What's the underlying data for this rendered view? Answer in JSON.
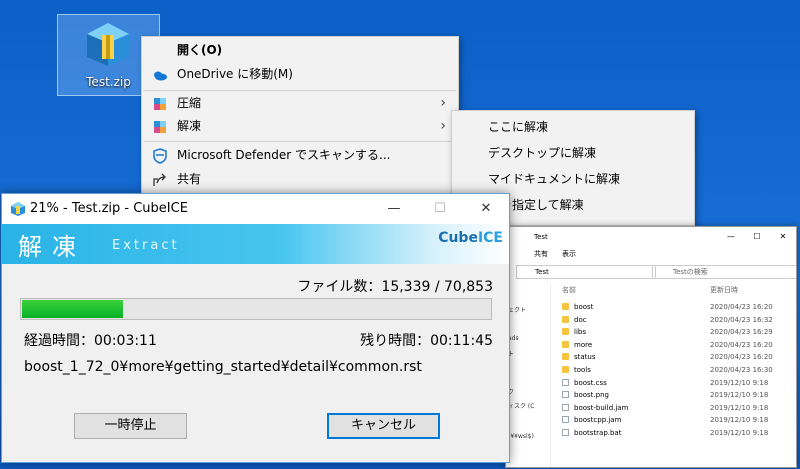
{
  "desktop": {
    "icon_label": "Test.zip"
  },
  "context_menu": {
    "items": [
      {
        "label": "開く(O)",
        "bold": true
      },
      {
        "label": "OneDrive に移動(M)"
      },
      {
        "label": "圧縮",
        "submenu": true
      },
      {
        "label": "解凍",
        "submenu": true
      },
      {
        "label": "Microsoft Defender でスキャンする..."
      },
      {
        "label": "共有"
      }
    ]
  },
  "submenu": {
    "items": [
      {
        "label": "ここに解凍"
      },
      {
        "label": "デスクトップに解凍"
      },
      {
        "label": "マイドキュメントに解凍"
      },
      {
        "label": "所を指定して解凍"
      }
    ]
  },
  "explorer": {
    "title": "Test",
    "ribbon": [
      "共有",
      "表示"
    ],
    "address": "Test",
    "search_placeholder": "Testの検索",
    "columns": {
      "name": "名前",
      "date": "更新日時"
    },
    "nav_items": [
      "ェクト",
      "ads",
      "ト",
      "ク",
      "ィスク (C",
      "(¥¥wsl$)"
    ],
    "rows": [
      {
        "name": "boost",
        "date": "2020/04/23 16:20",
        "type": "folder"
      },
      {
        "name": "doc",
        "date": "2020/04/23 16:32",
        "type": "folder"
      },
      {
        "name": "libs",
        "date": "2020/04/23 16:29",
        "type": "folder"
      },
      {
        "name": "more",
        "date": "2020/04/23 16:20",
        "type": "folder"
      },
      {
        "name": "status",
        "date": "2020/04/23 16:20",
        "type": "folder"
      },
      {
        "name": "tools",
        "date": "2020/04/23 16:30",
        "type": "folder"
      },
      {
        "name": "boost.css",
        "date": "2019/12/10 9:18",
        "type": "file"
      },
      {
        "name": "boost.png",
        "date": "2019/12/10 9:18",
        "type": "file"
      },
      {
        "name": "boost-build.jam",
        "date": "2019/12/10 9:18",
        "type": "file"
      },
      {
        "name": "boostcpp.jam",
        "date": "2019/12/10 9:18",
        "type": "file"
      },
      {
        "name": "bootstrap.bat",
        "date": "2019/12/10 9:18",
        "type": "file"
      }
    ]
  },
  "cubeice": {
    "title": "21% - Test.zip - CubeICE",
    "window_buttons": {
      "minimize": "—",
      "maximize": "☐",
      "close": "✕"
    },
    "banner": {
      "kanji": "解凍",
      "english": "Extract",
      "brand_cube": "Cube",
      "brand_ice": "ICE"
    },
    "file_count": "ファイル数：15,339 / 70,853",
    "progress": 0.215,
    "elapsed": "経過時間：00:03:11",
    "remaining": "残り時間：00:11:45",
    "current_file": "boost_1_72_0¥more¥getting_started¥detail¥common.rst",
    "pause_label": "一時停止",
    "cancel_label": "キャンセル"
  }
}
